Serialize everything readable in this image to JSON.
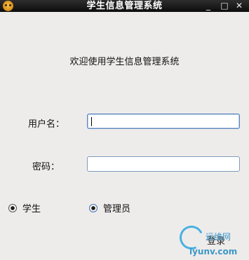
{
  "window": {
    "title": "学生信息管理系统",
    "controls": {
      "minimize": "_",
      "maximize": "□",
      "close": "✕"
    }
  },
  "welcome_text": "欢迎使用学生信息管理系统",
  "form": {
    "username_label": "用户名：",
    "username_value": "",
    "password_label": "密码：",
    "password_value": ""
  },
  "roles": {
    "student_label": "学生",
    "admin_label": "管理员"
  },
  "login_button": "登录",
  "watermark": {
    "text": "运维网",
    "url": "iyunv.com"
  }
}
